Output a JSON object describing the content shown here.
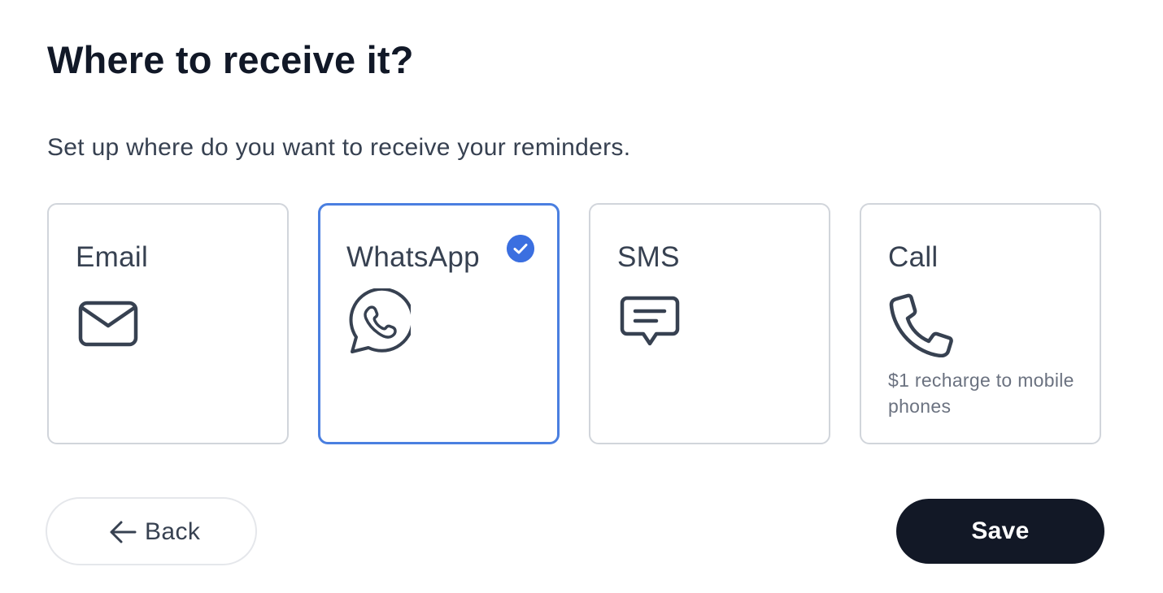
{
  "header": {
    "title": "Where to receive it?",
    "subtitle": "Set up where do you want to receive your reminders."
  },
  "channels": [
    {
      "label": "Email",
      "icon": "envelope-icon",
      "selected": false
    },
    {
      "label": "WhatsApp",
      "icon": "whatsapp-icon",
      "selected": true
    },
    {
      "label": "SMS",
      "icon": "chat-bubble-icon",
      "selected": false
    },
    {
      "label": "Call",
      "icon": "phone-icon",
      "selected": false,
      "note": "$1 recharge to mobile phones"
    }
  ],
  "actions": {
    "back_label": "Back",
    "save_label": "Save"
  },
  "colors": {
    "selected_border": "#4a7fe0",
    "check_badge": "#3b6fe0",
    "primary_button": "#121826",
    "card_border": "#d1d5db"
  }
}
